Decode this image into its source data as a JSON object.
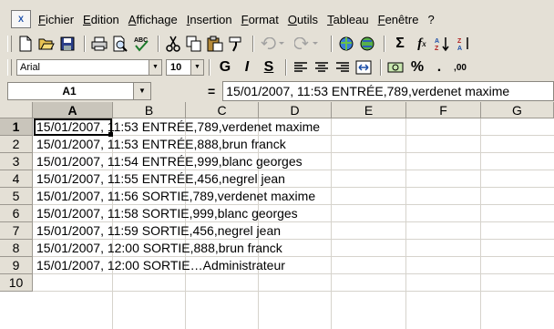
{
  "menu": {
    "items": [
      "Fichier",
      "Edition",
      "Affichage",
      "Insertion",
      "Format",
      "Outils",
      "Tableau",
      "Fenêtre",
      "?"
    ]
  },
  "format_toolbar": {
    "font_name": "Arial",
    "font_size": "10",
    "bold_label": "G",
    "italic_label": "I",
    "underline_label": "S",
    "percent_label": "%",
    "thousands_label": "."
  },
  "formula_bar": {
    "name_box": "A1",
    "equals": "=",
    "formula": "15/01/2007, 11:53 ENTRÉE,789,verdenet maxime"
  },
  "sheet": {
    "columns": [
      "A",
      "B",
      "C",
      "D",
      "E",
      "F",
      "G"
    ],
    "rows": [
      {
        "num": "1",
        "text": "15/01/2007, 11:53 ENTRÉE,789,verdenet maxime"
      },
      {
        "num": "2",
        "text": "15/01/2007, 11:53 ENTRÉE,888,brun franck"
      },
      {
        "num": "3",
        "text": "15/01/2007, 11:54 ENTRÉE,999,blanc georges"
      },
      {
        "num": "4",
        "text": "15/01/2007, 11:55 ENTRÉE,456,negrel jean"
      },
      {
        "num": "5",
        "text": "15/01/2007, 11:56 SORTIE,789,verdenet maxime"
      },
      {
        "num": "6",
        "text": "15/01/2007, 11:58 SORTIE,999,blanc georges"
      },
      {
        "num": "7",
        "text": "15/01/2007, 11:59 SORTIE,456,negrel jean"
      },
      {
        "num": "8",
        "text": "15/01/2007, 12:00 SORTIE,888,brun franck"
      },
      {
        "num": "9",
        "text": "15/01/2007, 12:00 SORTIE…Administrateur"
      },
      {
        "num": "10",
        "text": ""
      }
    ]
  },
  "colors": {
    "chrome": "#e4e0d6",
    "grid_line": "#d6d3cc",
    "selection": "#000000"
  }
}
